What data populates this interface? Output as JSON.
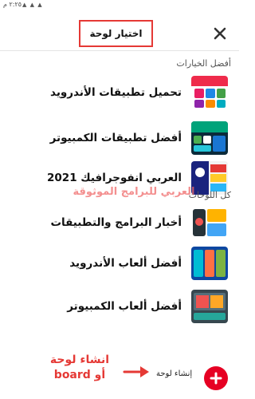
{
  "status_bar": {
    "time": "٢:٢٥ م",
    "icons": "▲ ▲ ▲"
  },
  "header": {
    "title": "اختيار لوحة",
    "close_icon": "close-icon"
  },
  "sections": {
    "top_choices_label": "أفضل الخيارات",
    "all_boards_label": "كل اللوحات"
  },
  "top_choices": [
    {
      "name": "تحميل تطبيقات الأندرويد"
    },
    {
      "name": "أفضل تطبيقات الكمبيوتر"
    },
    {
      "name": "العربي انفوجرافيك 2021"
    }
  ],
  "all_boards": [
    {
      "name": "أخبار البرامج والتطبيقات"
    },
    {
      "name": "أفضل ألعاب الأندرويد"
    },
    {
      "name": "أفضل ألعاب الكمبيوتر"
    }
  ],
  "watermark": "العربي للبرامج الموثوقة",
  "annotation": {
    "line1": "انشاء لوحة",
    "line2": "أو board"
  },
  "create": {
    "label": "إنشاء لوحة",
    "icon": "plus-icon"
  },
  "colors": {
    "accent": "#e60023",
    "highlight": "#e53935"
  }
}
